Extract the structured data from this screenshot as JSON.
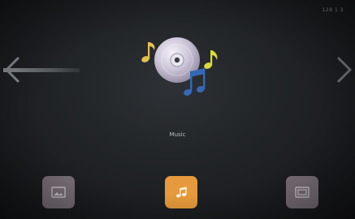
{
  "status": {
    "text": "128 1 3"
  },
  "hero": {
    "label": "Music",
    "icon": "cd-music-icon"
  },
  "dock": {
    "items": [
      {
        "id": "gallery",
        "icon": "image-icon",
        "active": false
      },
      {
        "id": "music",
        "icon": "music-note-icon",
        "active": true
      },
      {
        "id": "video",
        "icon": "video-icon",
        "active": false
      }
    ]
  },
  "nav": {
    "prev_icon": "chevron-left-icon",
    "next_icon": "chevron-right-icon"
  },
  "colors": {
    "background": "#1c1e21",
    "active": "#e69a3b",
    "inactive": "#8b7f88",
    "note_gold": "#e3c050",
    "note_yellow": "#d8dc3a",
    "note_blue": "#3569b8"
  }
}
